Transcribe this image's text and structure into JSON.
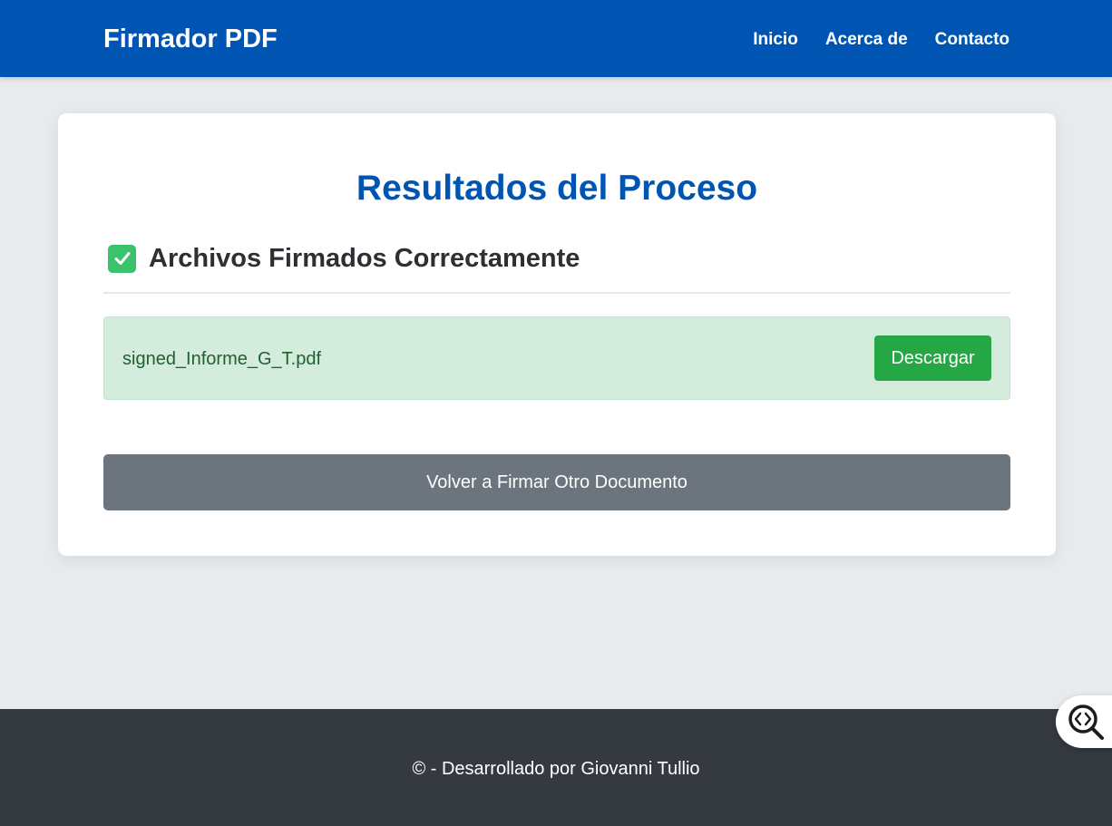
{
  "navbar": {
    "brand": "Firmador PDF",
    "links": [
      "Inicio",
      "Acerca de",
      "Contacto"
    ]
  },
  "main": {
    "title": "Resultados del Proceso",
    "section": {
      "icon": "check-mark-icon",
      "title": "Archivos Firmados Correctamente"
    },
    "files": [
      {
        "name": "signed_Informe_G_T.pdf",
        "action_label": "Descargar"
      }
    ],
    "back_button_label": "Volver a Firmar Otro Documento"
  },
  "footer": {
    "text": "© - Desarrollado por Giovanni Tullio"
  },
  "floating_widget": {
    "icon": "code-search-icon"
  },
  "colors": {
    "navbar": "#0055b3",
    "title": "#0055b3",
    "success_bg": "#d4ecdb",
    "success_button": "#26a745",
    "secondary_button": "#6c757e",
    "footer": "#343a40",
    "page_bg": "#e8ebee"
  }
}
